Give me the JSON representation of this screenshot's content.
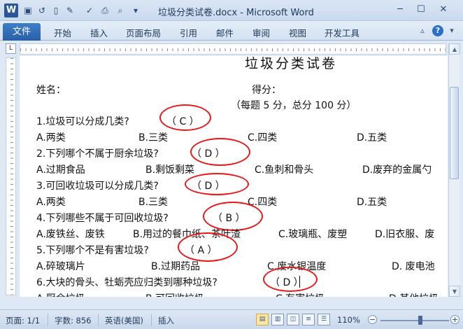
{
  "window": {
    "title": "垃圾分类试卷.docx - Microsoft Word",
    "logo_letter": "W",
    "controls": {
      "minimize": "─",
      "maximize": "☐",
      "close": "✕"
    }
  },
  "quick_access": {
    "icons": [
      "save-icon",
      "undo-icon",
      "new-document-icon",
      "format-painter-icon",
      "print-icon",
      "print-preview-icon",
      "customize-icon"
    ]
  },
  "ribbon": {
    "file_tab": "文件",
    "tabs": [
      "开始",
      "插入",
      "页面布局",
      "引用",
      "邮件",
      "审阅",
      "视图",
      "开发工具"
    ],
    "minimize_glyph": "▵",
    "help_glyph": "?",
    "help_dropdown": "▾"
  },
  "ruler_corner_glyph": "L",
  "scrollbar": {
    "up": "▲",
    "down": "▼"
  },
  "document": {
    "title": "垃圾分类试卷",
    "name_label": "姓名：",
    "score_label": "得分：",
    "score_note": "（每题 5 分，总分 100 分）",
    "questions": [
      {
        "q": "1.垃圾可以分成几类?",
        "answer": "（ C ）",
        "options": [
          "A.两类",
          "B.三类",
          "C.四类",
          "D.五类"
        ]
      },
      {
        "q": "2.下列哪个不属于厨余垃圾?",
        "answer": "（ D ）",
        "options": [
          "A.过期食品",
          "B.剩饭剩菜",
          "C.鱼刺和骨头",
          "D.废弃的金属勺"
        ]
      },
      {
        "q": "3.可回收垃圾可以分成几类?",
        "answer": "（ D ）",
        "options": [
          "A.两类",
          "B.三类",
          "C.四类",
          "D.五类"
        ]
      },
      {
        "q": "4.下列哪些不属于可回收垃圾?",
        "answer": "（ B ）",
        "options": [
          "A.废铁丝、废铁",
          "B.用过的餐巾纸、茶叶渣",
          "C.玻璃瓶、废塑",
          "D.旧衣服、废"
        ]
      },
      {
        "q": "5.下列哪个不是有害垃圾?",
        "answer": "（ A ）",
        "options": [
          "A.碎玻璃片",
          "B.过期药品",
          "C.废水银温度",
          "D. 废电池"
        ]
      },
      {
        "q": "6.大块的骨头、牡蛎壳应归类到哪种垃圾?",
        "answer": "（ D ）",
        "options": [
          "A.厨余垃圾",
          "B.可回收垃圾",
          "C.有害垃圾",
          "D.其他垃圾"
        ]
      }
    ]
  },
  "status_bar": {
    "page": "页面: 1/1",
    "words": "字数: 856",
    "language": "英语(美国)",
    "mode": "插入",
    "zoom": "110%",
    "zoom_minus": "−",
    "zoom_plus": "+"
  },
  "colors": {
    "accent": "#2a5fa8",
    "annotation_red": "#e8191b"
  }
}
